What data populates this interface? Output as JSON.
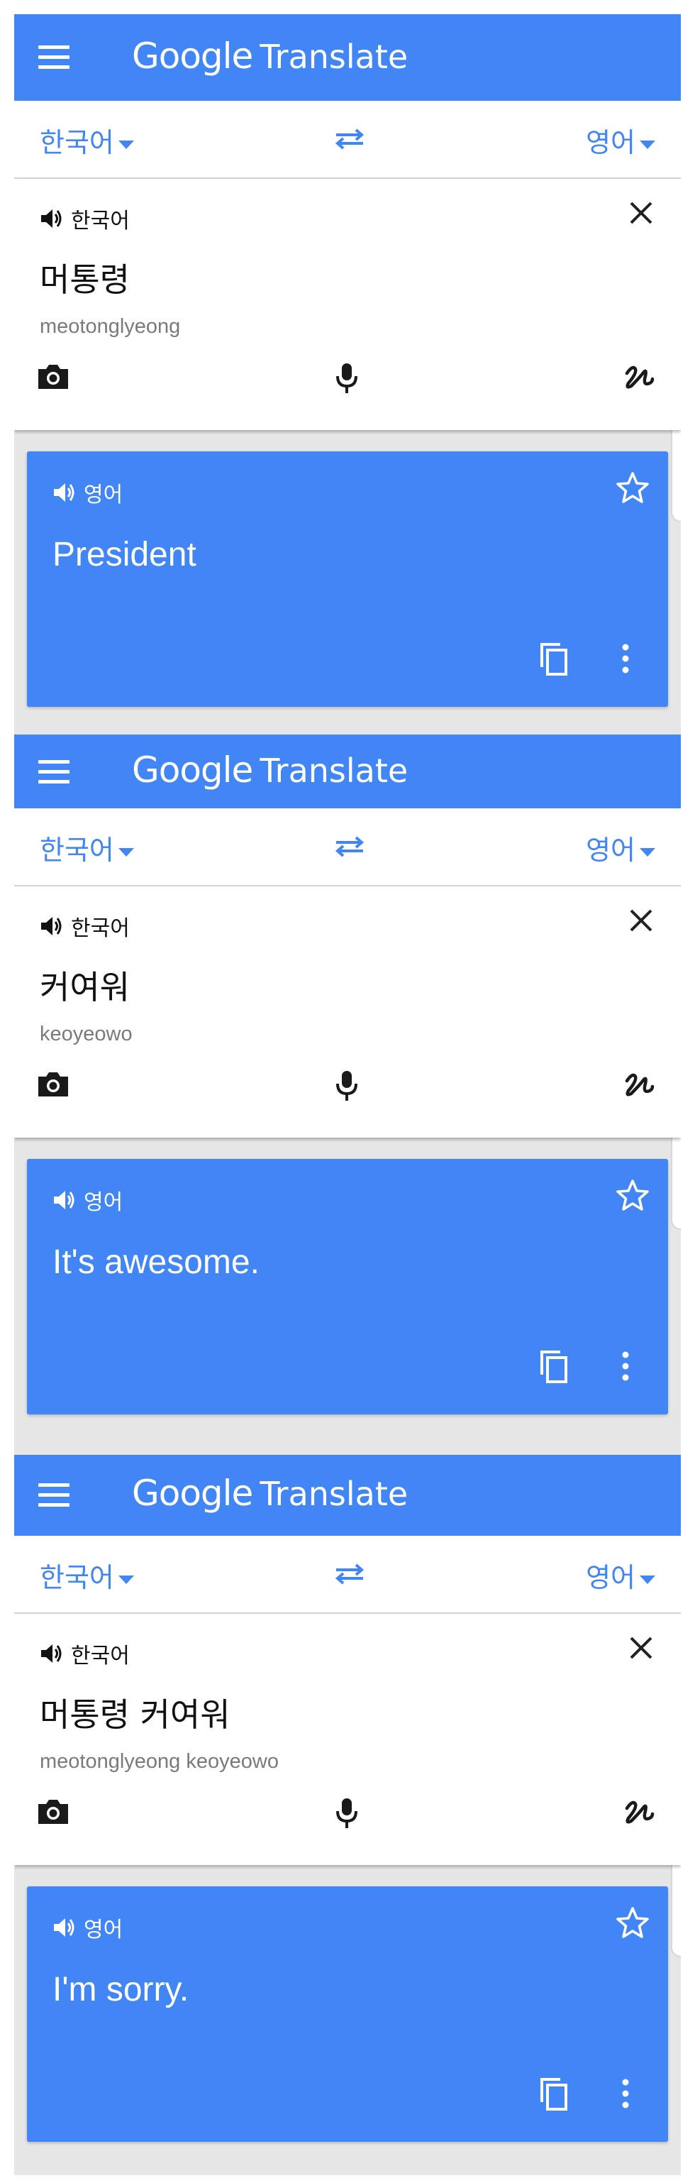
{
  "app": {
    "brand_google": "Google",
    "brand_translate": "Translate"
  },
  "colors": {
    "primary": "#4285f4",
    "toolbar_text": "#ffffff",
    "background": "#e6e6e6"
  },
  "screens": [
    {
      "source_lang": "한국어",
      "target_lang": "영어",
      "input_lang_label": "한국어",
      "source_text": "머통령",
      "romanization": "meotonglyeong",
      "output_lang_label": "영어",
      "translation": "President"
    },
    {
      "source_lang": "한국어",
      "target_lang": "영어",
      "input_lang_label": "한국어",
      "source_text": "커여워",
      "romanization": "keoyeowo",
      "output_lang_label": "영어",
      "translation": "It's awesome."
    },
    {
      "source_lang": "한국어",
      "target_lang": "영어",
      "input_lang_label": "한국어",
      "source_text": "머통령 커여워",
      "romanization": "meotonglyeong keoyeowo",
      "output_lang_label": "영어",
      "translation": "I'm sorry."
    }
  ],
  "icons": [
    "menu-icon",
    "swap-languages-icon",
    "speaker-icon",
    "close-icon",
    "camera-icon",
    "microphone-icon",
    "handwriting-icon",
    "star-icon",
    "copy-icon",
    "more-vert-icon"
  ]
}
